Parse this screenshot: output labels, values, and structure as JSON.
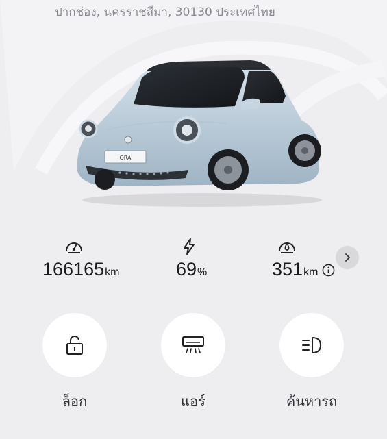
{
  "location": {
    "address": "ปากช่อง, นครราชสีมา, 30130 ประเทศไทย"
  },
  "vehicle": {
    "image": "car-image",
    "plate_text": "ORA"
  },
  "stats": [
    {
      "icon": "speedometer-icon",
      "value": "166165",
      "unit": "km"
    },
    {
      "icon": "lightning-bolt-icon",
      "value": "69",
      "unit": "%"
    },
    {
      "icon": "range-gauge-icon",
      "value": "351",
      "unit": "km"
    }
  ],
  "controls": [
    {
      "icon": "unlocked-padlock-icon",
      "label": "ล็อก"
    },
    {
      "icon": "air-conditioner-icon",
      "label": "แอร์"
    },
    {
      "icon": "headlight-icon",
      "label": "ค้นหารถ"
    }
  ],
  "colors": {
    "background": "#eeeef0",
    "text": "#1a1a1a",
    "muted": "#8a8a92",
    "button_bg": "#ffffff"
  }
}
